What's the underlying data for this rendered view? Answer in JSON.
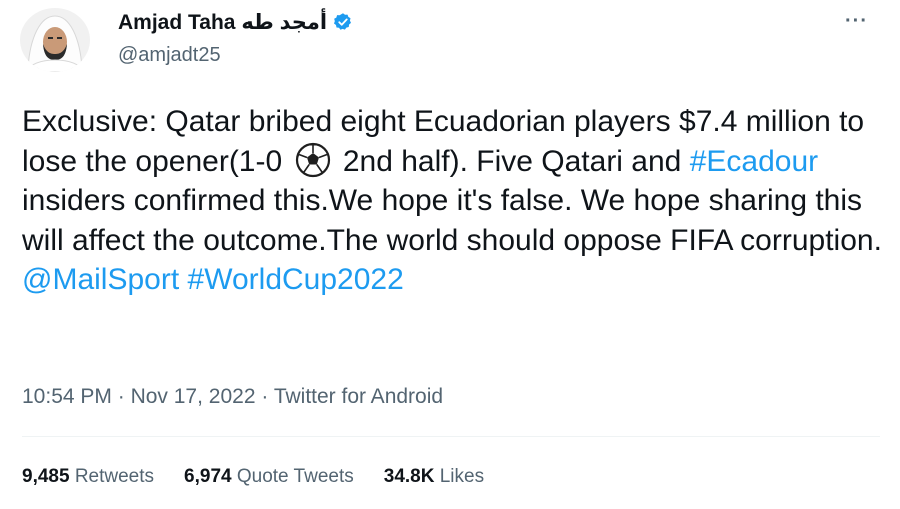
{
  "author": {
    "display_name": "Amjad Taha أمجد طه",
    "handle": "@amjadt25",
    "verified": true,
    "avatar_icon": "profile-photo"
  },
  "menu": {
    "more_label": "···"
  },
  "tweet": {
    "part1": "Exclusive: Qatar bribed eight Ecuadorian players $7.4 million to lose the opener(1-0 ",
    "emoji_icon": "soccer-ball-icon",
    "part2": " 2nd half). Five Qatari and ",
    "hashtag1": "#Ecadour",
    "part3": " insiders confirmed this.We hope it's false. We hope sharing this will affect the outcome.The world should oppose FIFA corruption.",
    "mention": "@MailSport",
    "hashtag2": "#WorldCup2022"
  },
  "meta": {
    "time": "10:54 PM",
    "date": "Nov 17, 2022",
    "source": "Twitter for Android",
    "sep": "·"
  },
  "stats": {
    "retweets_count": "9,485",
    "retweets_label": "Retweets",
    "quotes_count": "6,974",
    "quotes_label": "Quote Tweets",
    "likes_count": "34.8K",
    "likes_label": "Likes"
  },
  "colors": {
    "link": "#1d9bf0",
    "secondary": "#536471",
    "text": "#0f1419",
    "verified": "#1d9bf0"
  }
}
